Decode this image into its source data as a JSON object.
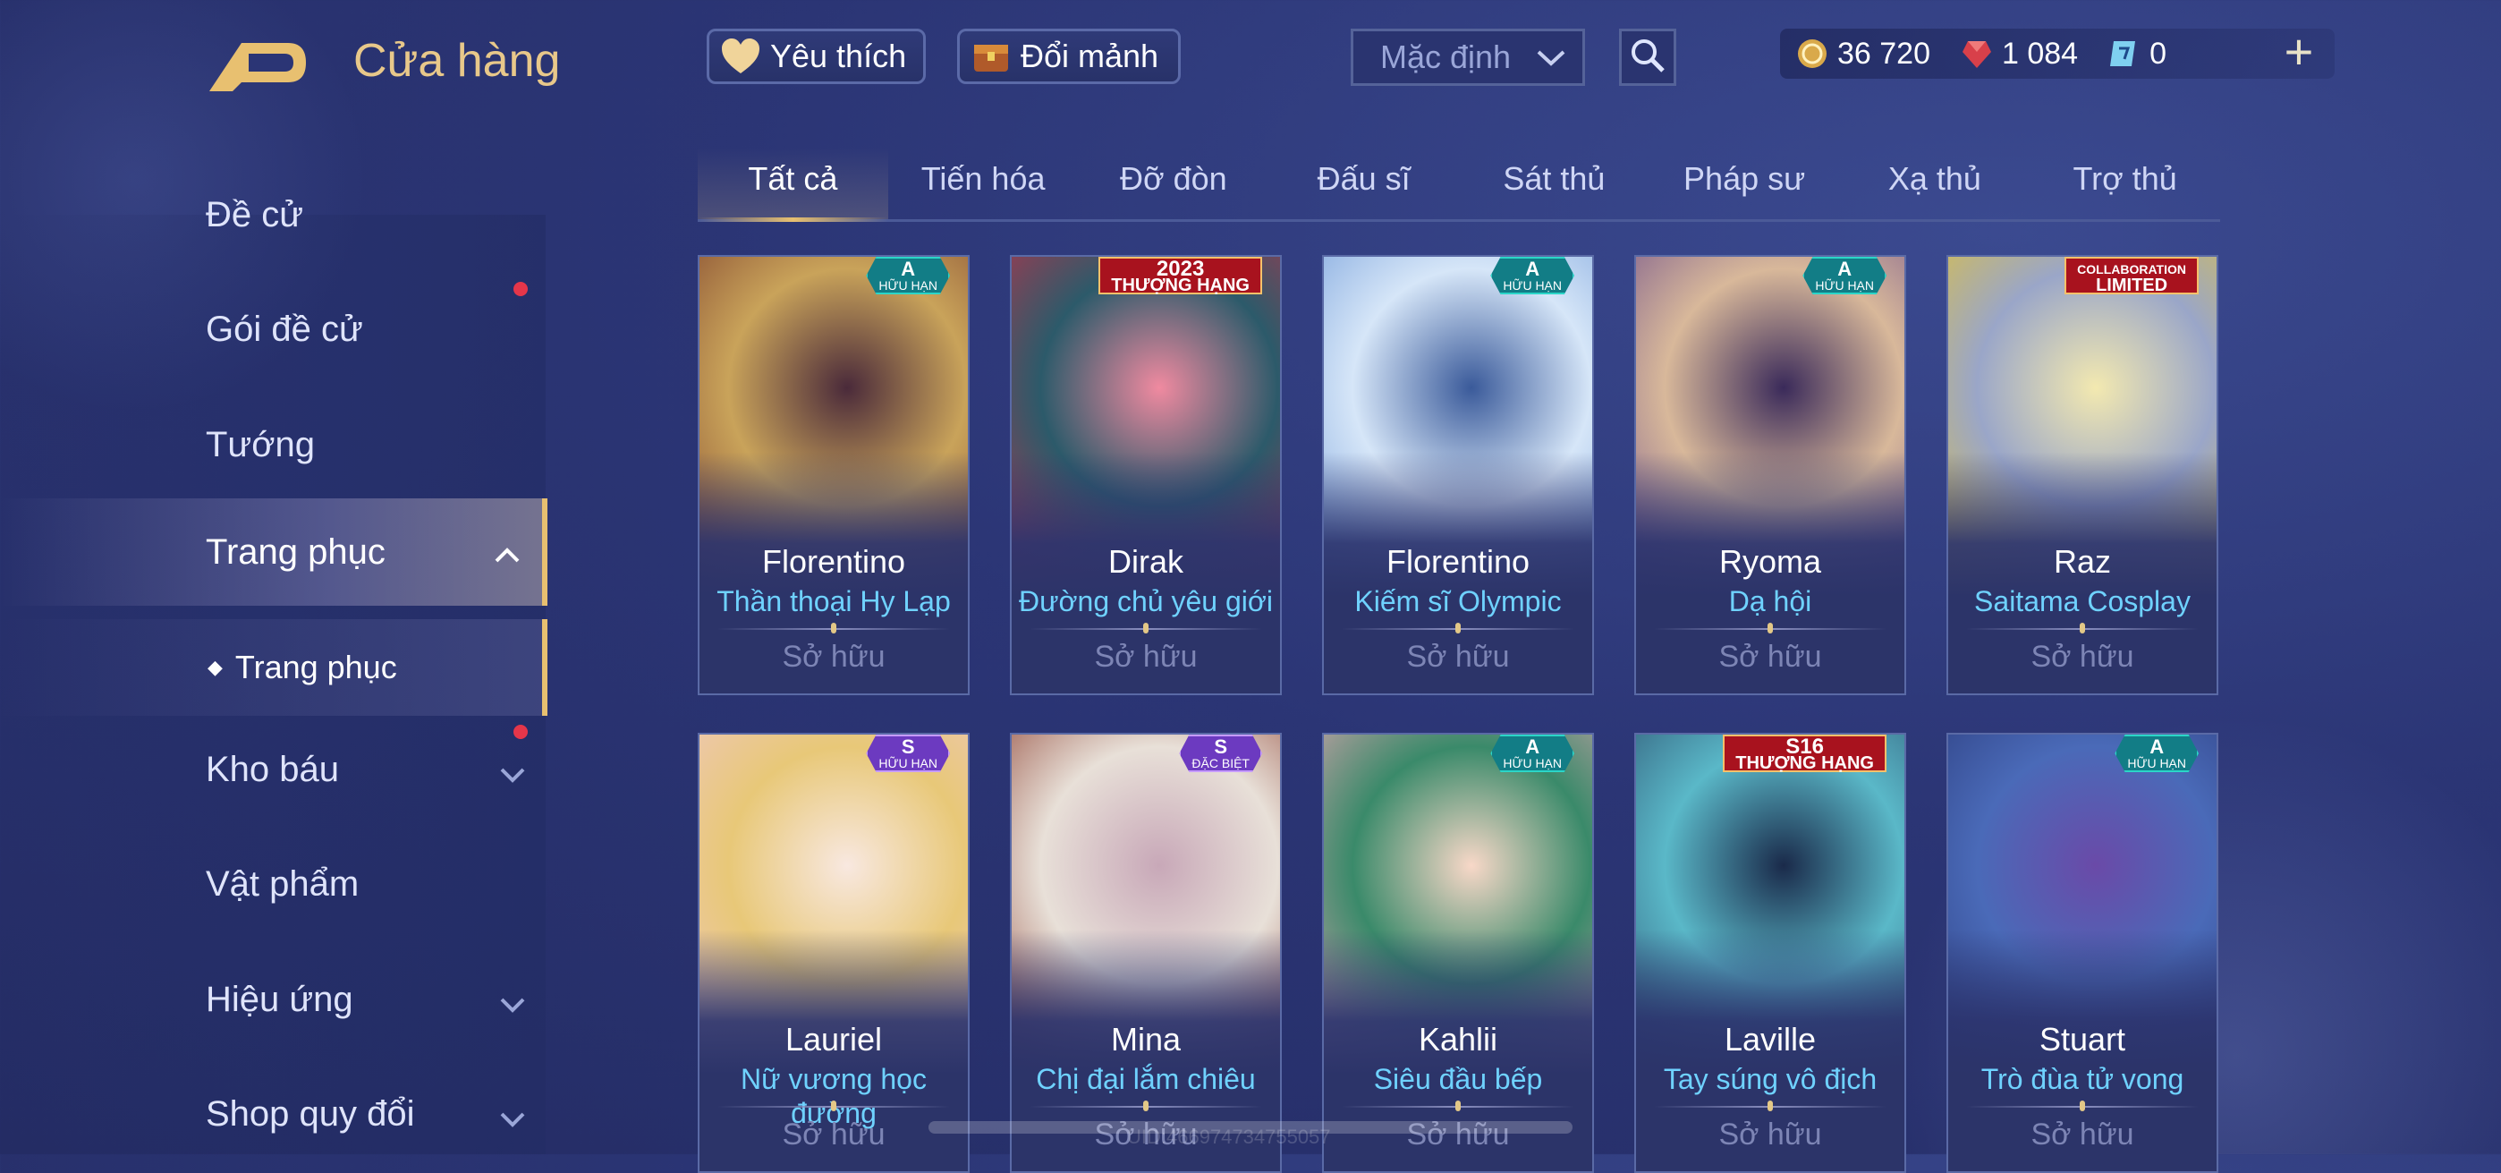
{
  "header": {
    "title": "Cửa hàng",
    "favorite_label": "Yêu thích",
    "fragment_label": "Đổi mảnh",
    "sort_value": "Mặc định"
  },
  "currencies": [
    {
      "icon": "gold-coin-icon",
      "value": "36 720"
    },
    {
      "icon": "red-gem-icon",
      "value": "1 084"
    },
    {
      "icon": "voucher-icon",
      "value": "0"
    }
  ],
  "tabs": [
    "Tất cả",
    "Tiến hóa",
    "Đỡ đòn",
    "Đấu sĩ",
    "Sát thủ",
    "Pháp sư",
    "Xạ thủ",
    "Trợ thủ"
  ],
  "sidebar": {
    "items": [
      {
        "label": "Đề cử"
      },
      {
        "label": "Gói đề cử"
      },
      {
        "label": "Tướng"
      },
      {
        "label": "Trang phục"
      },
      {
        "label": "Kho báu"
      },
      {
        "label": "Vật phẩm"
      },
      {
        "label": "Hiệu ứng"
      },
      {
        "label": "Shop quy đổi"
      }
    ],
    "sub_item": "Trang phục"
  },
  "cards": [
    {
      "hero": "Florentino",
      "skin": "Thần thoại Hy Lạp",
      "status": "Sở hữu",
      "badge_tier": "A",
      "badge_text": "HỮU HẠN",
      "badge_style": "teal",
      "colors": [
        "#7a3b2a",
        "#c9a35a",
        "#4a2a3a"
      ]
    },
    {
      "hero": "Dirak",
      "skin": "Đường chủ yêu giới",
      "status": "Sở hữu",
      "badge_tier": "2023",
      "badge_text": "THƯỢNG HẠNG",
      "badge_style": "red",
      "colors": [
        "#c63048",
        "#2c5a6a",
        "#f08aa0"
      ]
    },
    {
      "hero": "Florentino",
      "skin": "Kiếm sĩ Olympic",
      "status": "Sở hữu",
      "badge_tier": "A",
      "badge_text": "HỮU HẠN",
      "badge_style": "teal",
      "colors": [
        "#6f9ad8",
        "#d6e6f8",
        "#3a5a9a"
      ]
    },
    {
      "hero": "Ryoma",
      "skin": "Dạ hội",
      "status": "Sở hữu",
      "badge_tier": "A",
      "badge_text": "HỮU HẠN",
      "badge_style": "teal",
      "colors": [
        "#6a4a8a",
        "#d8b89a",
        "#3a2a5a"
      ]
    },
    {
      "hero": "Raz",
      "skin": "Saitama Cosplay",
      "status": "Sở hữu",
      "badge_tier": "COLLABORATION",
      "badge_text": "LIMITED",
      "badge_style": "red",
      "colors": [
        "#e6c430",
        "#9aa6c8",
        "#f3e9b0"
      ]
    },
    {
      "hero": "Lauriel",
      "skin": "Nữ vương học đường",
      "status": "Sở hữu",
      "badge_tier": "S",
      "badge_text": "HỮU HẠN",
      "badge_style": "purple",
      "colors": [
        "#f0c8c8",
        "#e8c878",
        "#f8e8e0"
      ]
    },
    {
      "hero": "Mina",
      "skin": "Chị đại lắm chiêu",
      "status": "Sở hữu",
      "badge_tier": "S",
      "badge_text": "ĐẶC BIỆT",
      "badge_style": "purple",
      "colors": [
        "#8a3a2a",
        "#e8e0d8",
        "#c8a8b8"
      ]
    },
    {
      "hero": "Kahlii",
      "skin": "Siêu đầu bếp",
      "status": "Sở hữu",
      "badge_tier": "A",
      "badge_text": "HỮU HẠN",
      "badge_style": "teal",
      "colors": [
        "#f0a8b8",
        "#3a8a6a",
        "#f8d8c8"
      ]
    },
    {
      "hero": "Laville",
      "skin": "Tay súng vô địch",
      "status": "Sở hữu",
      "badge_tier": "S16",
      "badge_text": "THƯỢNG HẠNG",
      "badge_style": "red",
      "colors": [
        "#2a4a6a",
        "#5ab8c8",
        "#1a2a4a"
      ]
    },
    {
      "hero": "Stuart",
      "skin": "Trò đùa tử vong",
      "status": "Sở hữu",
      "badge_tier": "A",
      "badge_text": "HỮU HẠN",
      "badge_style": "teal",
      "colors": [
        "#2a3a7a",
        "#4a6ab8",
        "#6a4aa8"
      ]
    }
  ],
  "footer": {
    "uid_text": "UID:466974734755057"
  }
}
